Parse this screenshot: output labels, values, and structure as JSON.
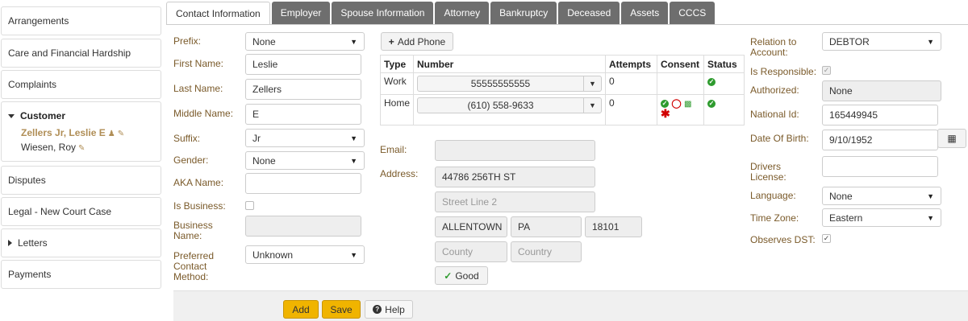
{
  "sidebar": {
    "arrangements": "Arrangements",
    "care": "Care and Financial Hardship",
    "complaints": "Complaints",
    "customer": "Customer",
    "customer_primary": "Zellers Jr, Leslie E",
    "customer_secondary": "Wiesen, Roy",
    "disputes": "Disputes",
    "legal": "Legal - New Court Case",
    "letters": "Letters",
    "payments": "Payments"
  },
  "tabs": [
    "Contact Information",
    "Employer",
    "Spouse Information",
    "Attorney",
    "Bankruptcy",
    "Deceased",
    "Assets",
    "CCCS"
  ],
  "form": {
    "prefix_label": "Prefix:",
    "prefix_value": "None",
    "first_label": "First Name:",
    "first_value": "Leslie",
    "last_label": "Last Name:",
    "last_value": "Zellers",
    "middle_label": "Middle Name:",
    "middle_value": "E",
    "suffix_label": "Suffix:",
    "suffix_value": "Jr",
    "gender_label": "Gender:",
    "gender_value": "None",
    "aka_label": "AKA Name:",
    "aka_value": "",
    "isbiz_label": "Is Business:",
    "bizname_label": "Business Name:",
    "pcm_label": "Preferred Contact Method:",
    "pcm_value": "Unknown"
  },
  "phones": {
    "add_label": "Add Phone",
    "headers": [
      "Type",
      "Number",
      "Attempts",
      "Consent",
      "Status"
    ],
    "rows": [
      {
        "type": "Work",
        "number": "55555555555",
        "attempts": "0"
      },
      {
        "type": "Home",
        "number": "(610) 558-9633",
        "attempts": "0"
      }
    ]
  },
  "address": {
    "email_label": "Email:",
    "email_value": "",
    "address_label": "Address:",
    "line1": "44786 256TH ST",
    "line2_placeholder": "Street Line 2",
    "city": "ALLENTOWN",
    "state": "PA",
    "zip": "18101",
    "county_placeholder": "County",
    "country_placeholder": "Country",
    "good_label": "Good"
  },
  "right": {
    "relation_label": "Relation to Account:",
    "relation_value": "DEBTOR",
    "responsible_label": "Is Responsible:",
    "authorized_label": "Authorized:",
    "authorized_value": "None",
    "national_label": "National Id:",
    "national_value": "165449945",
    "dob_label": "Date Of Birth:",
    "dob_value": "9/10/1952",
    "dl_label": "Drivers License:",
    "dl_value": "",
    "language_label": "Language:",
    "language_value": "None",
    "tz_label": "Time Zone:",
    "tz_value": "Eastern",
    "dst_label": "Observes DST:"
  },
  "footer": {
    "add": "Add",
    "save": "Save",
    "help": "Help"
  },
  "colors": {
    "label": "#7a5a2a",
    "button_yellow": "#f0b400",
    "icon_green": "#2e9b2e",
    "icon_red": "#d10000",
    "tab_inactive": "#6e6e6e"
  }
}
